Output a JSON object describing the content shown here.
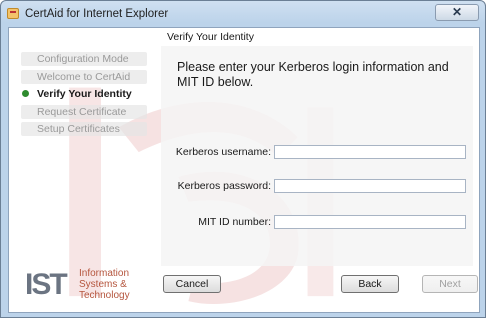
{
  "window": {
    "title": "CertAid for Internet Explorer",
    "close_glyph": "✕"
  },
  "steps": [
    {
      "label": "Configuration Mode",
      "state": "done"
    },
    {
      "label": "Welcome to CertAid",
      "state": "done"
    },
    {
      "label": "Verify Your Identity",
      "state": "active"
    },
    {
      "label": "Request Certificate",
      "state": "pending"
    },
    {
      "label": "Setup Certificates",
      "state": "pending"
    }
  ],
  "main": {
    "header": "Verify Your Identity",
    "instructions": "Please enter your Kerberos login information and MIT ID below.",
    "fields": {
      "username": {
        "label": "Kerberos username:",
        "value": ""
      },
      "password": {
        "label": "Kerberos password:",
        "value": ""
      },
      "mit_id": {
        "label": "MIT ID number:",
        "value": ""
      }
    }
  },
  "buttons": {
    "cancel": "Cancel",
    "back": "Back",
    "next": "Next"
  },
  "logo": {
    "mark": "IST",
    "line1": "Information",
    "line2": "Systems &",
    "line3": "Technology"
  },
  "colors": {
    "accent_green": "#2e8b2e",
    "watermark_red": "#e8b7b7"
  }
}
